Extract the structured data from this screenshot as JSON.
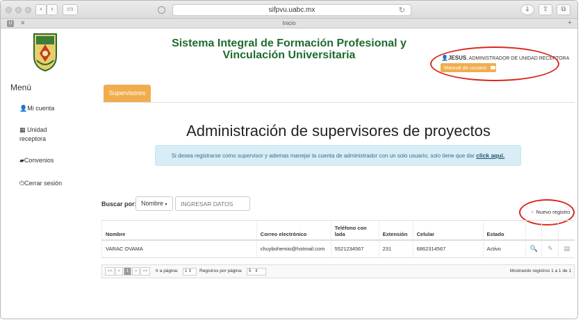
{
  "browser": {
    "url": "sifpvu.uabc.mx",
    "tab_title": "Inicio",
    "reload_icon": "↻"
  },
  "header": {
    "title": "Sistema Integral de Formación Profesional y Vinculación Universitaria",
    "user_name": "JESUS",
    "user_role": "ADMINISTRADOR DE UNIDAD RECEPTORA",
    "manual_label": "Manual de usuario"
  },
  "sidebar": {
    "title": "Menú",
    "items": [
      {
        "label": "Mi cuenta",
        "icon": "user-icon"
      },
      {
        "label": "Unidad receptora",
        "icon": "grid-icon"
      },
      {
        "label": "Convenios",
        "icon": "folder-icon"
      },
      {
        "label": "Cerrar sesión",
        "icon": "power-icon"
      }
    ]
  },
  "main": {
    "tab_label": "Supervisores",
    "heading": "Administración de supervisores de proyectos",
    "info_text": "Si desea registrarse como supervisor y ademas manejar la cuenta de administrador con un solo usuario, solo tiene que dar",
    "info_link": "click aquí.",
    "search_label": "Buscar por:",
    "search_field": "Nombre",
    "search_placeholder": "INGRESAR DATOS",
    "new_record_label": "Nuevo registro"
  },
  "table": {
    "headers": [
      "Nombre",
      "Correo electrónico",
      "Teléfono con lada",
      "Extensión",
      "Celular",
      "Estado"
    ],
    "rows": [
      {
        "nombre": "VARAC OVAMA",
        "correo": "chuybohemio@hotmail.com",
        "telefono": "5521234567",
        "extension": "231",
        "celular": "6862314567",
        "estado": "Activo"
      }
    ]
  },
  "pager": {
    "first": "<<",
    "prev": "<",
    "current_page": "1",
    "next": ">",
    "last": ">>",
    "goto_label": "Ir a página:",
    "goto_value": "1",
    "per_page_label": "Registros por página:",
    "per_page_value": "5",
    "summary": "Mostrando registros 1 a 1 de 1"
  },
  "colors": {
    "accent": "#f0ad4e",
    "title_green": "#1e6a2e",
    "annotation_red": "#d9271c"
  }
}
